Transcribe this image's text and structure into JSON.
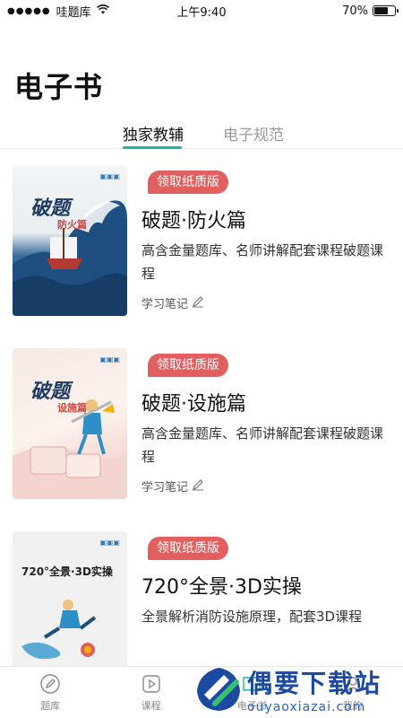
{
  "status_bar": {
    "signal_dots": "●●●●●",
    "carrier": "哇题库",
    "time": "上午9:40",
    "battery_percent_text": "70%",
    "battery_level": 0.7
  },
  "header": {
    "title": "电子书"
  },
  "tabs": [
    {
      "label": "独家教辅",
      "active": true
    },
    {
      "label": "电子规范",
      "active": false
    }
  ],
  "books": [
    {
      "badge": "领取纸质版",
      "title": "破题·防火篇",
      "description": "高含金量题库、名师讲解配套课程破题课程",
      "note_label": "学习笔记",
      "cover": {
        "title": "破题",
        "subtitle": "防火篇"
      }
    },
    {
      "badge": "领取纸质版",
      "title": "破题·设施篇",
      "description": "高含金量题库、名师讲解配套课程破题课程",
      "note_label": "学习笔记",
      "cover": {
        "title": "破题",
        "subtitle": "设施篇"
      }
    },
    {
      "badge": "领取纸质版",
      "title": "720°全景·3D实操",
      "description": "全景解析消防设施原理，配套3D课程",
      "cover": {
        "title": "720°全景·3D实操"
      }
    }
  ],
  "bottom_nav": [
    {
      "label": "题库",
      "icon": "pencil-icon"
    },
    {
      "label": "课程",
      "icon": "video-play-icon"
    },
    {
      "label": "电子书",
      "icon": "book-icon"
    },
    {
      "label": "我的",
      "icon": "user-icon"
    }
  ],
  "watermark": {
    "text_cn": "偶要下载站",
    "text_en": "ouyaoxiazai.com"
  },
  "colors": {
    "accent": "#22b3a3",
    "badge": "#e15f5f",
    "watermark": "#1c4aa0"
  }
}
